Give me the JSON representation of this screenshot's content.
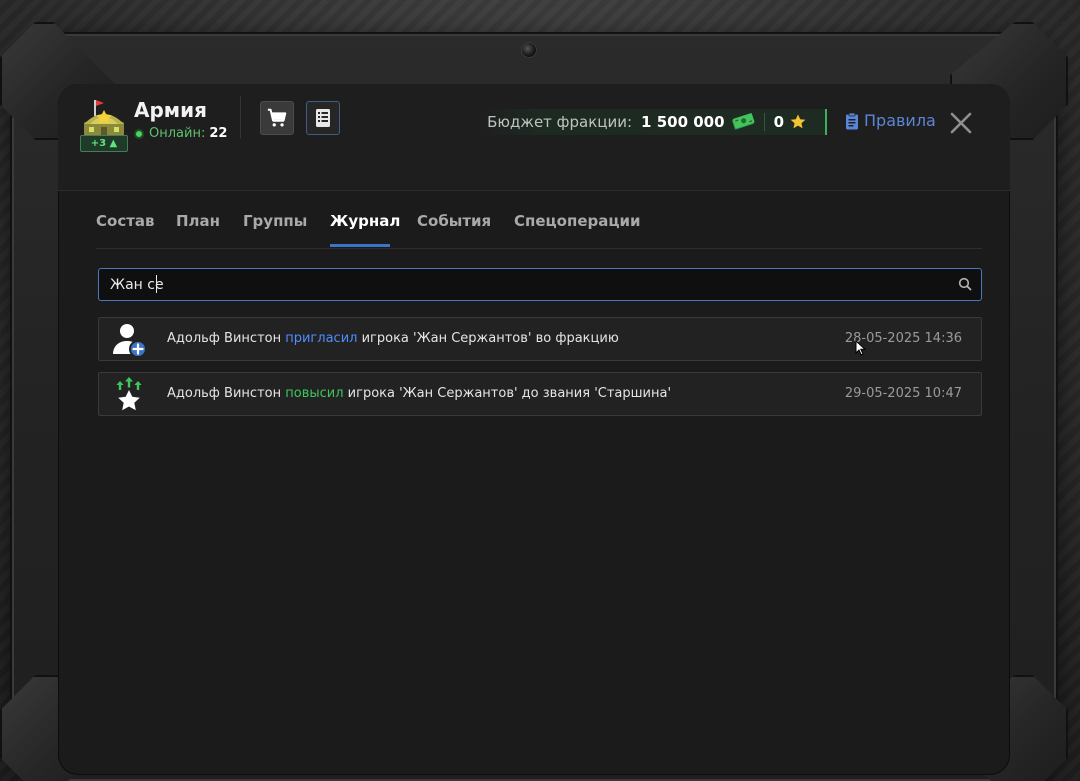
{
  "faction": {
    "name": "Армия",
    "level_badge": "+3",
    "online_label": "Онлайн:",
    "online_count": "22"
  },
  "header": {
    "budget_label": "Бюджет фракции:",
    "budget_money": "1 500 000",
    "budget_stars": "0",
    "rules_label": "Правила"
  },
  "tabs": [
    {
      "label": "Состав",
      "active": false
    },
    {
      "label": "План",
      "active": false
    },
    {
      "label": "Группы",
      "active": false
    },
    {
      "label": "Журнал",
      "active": true
    },
    {
      "label": "События",
      "active": false
    },
    {
      "label": "Спецоперации",
      "active": false
    }
  ],
  "search": {
    "value": "Жан се"
  },
  "log": [
    {
      "icon": "user-add-icon",
      "actor": "Адольф Винстон",
      "action": "пригласил",
      "rest": "игрока 'Жан Сержантов' во фракцию",
      "date": "28-05-2025 14:36"
    },
    {
      "icon": "rank-up-star-icon",
      "actor": "Адольф Винстон",
      "action": "повысил",
      "rest": "игрока 'Жан Сержантов' до звания 'Старшина'",
      "date": "29-05-2025 10:47"
    }
  ],
  "colors": {
    "accent_blue": "#3b73c9",
    "link_blue": "#4f8cff",
    "online_green": "#4cd35f",
    "budget_green": "#36b35a",
    "star_yellow": "#f5c431"
  }
}
